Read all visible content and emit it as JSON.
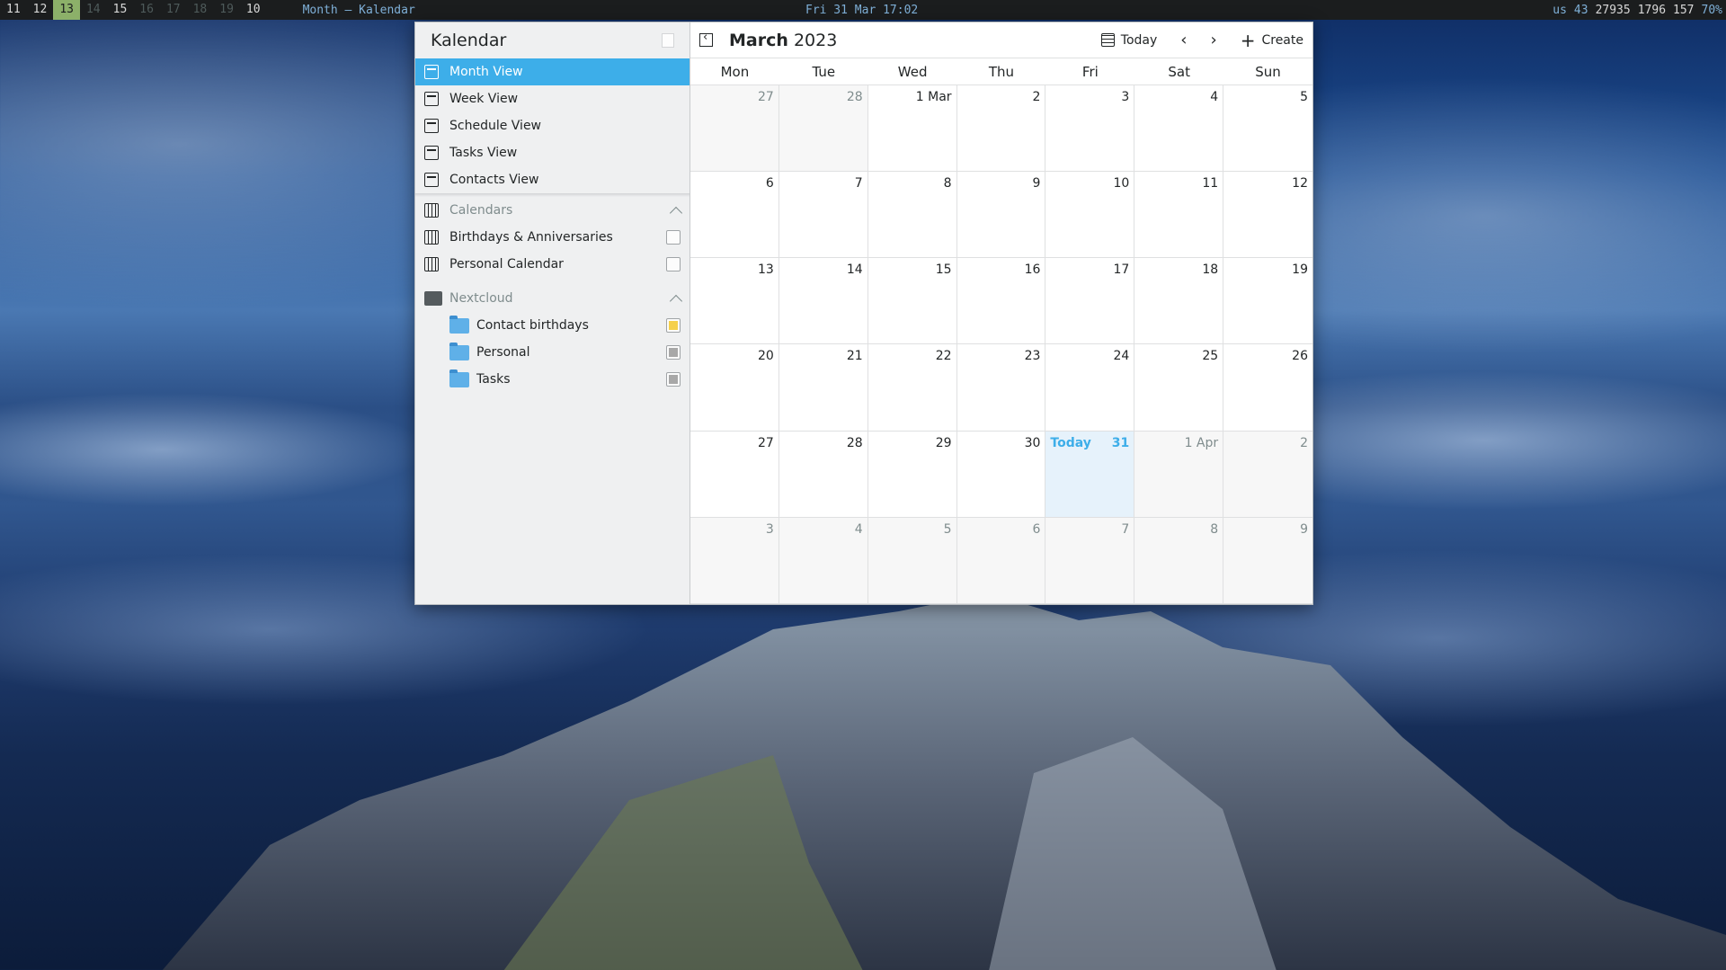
{
  "topbar": {
    "workspaces": [
      {
        "label": "11",
        "state": "normal"
      },
      {
        "label": "12",
        "state": "normal"
      },
      {
        "label": "13",
        "state": "active"
      },
      {
        "label": "14",
        "state": "dim"
      },
      {
        "label": "15",
        "state": "normal"
      },
      {
        "label": "16",
        "state": "dim"
      },
      {
        "label": "17",
        "state": "dim"
      },
      {
        "label": "18",
        "state": "dim"
      },
      {
        "label": "19",
        "state": "dim"
      },
      {
        "label": "10",
        "state": "normal"
      }
    ],
    "window_title": "Month — Kalendar",
    "clock": "Fri 31 Mar 17:02",
    "status": {
      "keyboard": "us",
      "mail_count": "43",
      "btc": "27935",
      "eth": "1796",
      "mastodon": "157",
      "volume": "70%"
    }
  },
  "app": {
    "name": "Kalendar",
    "views": [
      {
        "label": "Month View",
        "selected": true
      },
      {
        "label": "Week View",
        "selected": false
      },
      {
        "label": "Schedule View",
        "selected": false
      },
      {
        "label": "Tasks View",
        "selected": false
      },
      {
        "label": "Contacts View",
        "selected": false
      }
    ],
    "calendars_section": "Calendars",
    "calendars": [
      {
        "label": "Birthdays & Anniversaries",
        "color": "#fcfcfc"
      },
      {
        "label": "Personal Calendar",
        "color": "#fcfcfc"
      }
    ],
    "nextcloud_section": "Nextcloud",
    "nextcloud": [
      {
        "label": "Contact birthdays",
        "color": "#f5d04b"
      },
      {
        "label": "Personal",
        "color": "#a8a8a8"
      },
      {
        "label": "Tasks",
        "color": "#a8a8a8"
      }
    ]
  },
  "toolbar": {
    "month": "March",
    "year": "2023",
    "today_label": "Today",
    "create_label": "Create"
  },
  "weekdays": [
    "Mon",
    "Tue",
    "Wed",
    "Thu",
    "Fri",
    "Sat",
    "Sun"
  ],
  "today_label": "Today",
  "colors": {
    "accent": "#3daee9"
  },
  "days": [
    {
      "n": "27",
      "out": true
    },
    {
      "n": "28",
      "out": true
    },
    {
      "n": "1 Mar",
      "out": false
    },
    {
      "n": "2",
      "out": false
    },
    {
      "n": "3",
      "out": false
    },
    {
      "n": "4",
      "out": false
    },
    {
      "n": "5",
      "out": false
    },
    {
      "n": "6",
      "out": false
    },
    {
      "n": "7",
      "out": false
    },
    {
      "n": "8",
      "out": false
    },
    {
      "n": "9",
      "out": false
    },
    {
      "n": "10",
      "out": false
    },
    {
      "n": "11",
      "out": false
    },
    {
      "n": "12",
      "out": false
    },
    {
      "n": "13",
      "out": false
    },
    {
      "n": "14",
      "out": false
    },
    {
      "n": "15",
      "out": false
    },
    {
      "n": "16",
      "out": false
    },
    {
      "n": "17",
      "out": false
    },
    {
      "n": "18",
      "out": false
    },
    {
      "n": "19",
      "out": false
    },
    {
      "n": "20",
      "out": false
    },
    {
      "n": "21",
      "out": false
    },
    {
      "n": "22",
      "out": false
    },
    {
      "n": "23",
      "out": false
    },
    {
      "n": "24",
      "out": false
    },
    {
      "n": "25",
      "out": false
    },
    {
      "n": "26",
      "out": false
    },
    {
      "n": "27",
      "out": false
    },
    {
      "n": "28",
      "out": false
    },
    {
      "n": "29",
      "out": false
    },
    {
      "n": "30",
      "out": false
    },
    {
      "n": "31",
      "out": false,
      "today": true
    },
    {
      "n": "1 Apr",
      "out": true
    },
    {
      "n": "2",
      "out": true
    },
    {
      "n": "3",
      "out": true
    },
    {
      "n": "4",
      "out": true
    },
    {
      "n": "5",
      "out": true
    },
    {
      "n": "6",
      "out": true
    },
    {
      "n": "7",
      "out": true
    },
    {
      "n": "8",
      "out": true
    },
    {
      "n": "9",
      "out": true
    }
  ]
}
